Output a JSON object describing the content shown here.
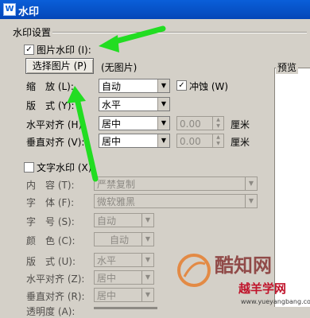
{
  "window": {
    "title": "水印"
  },
  "section": {
    "title": "水印设置",
    "preview_label": "预览"
  },
  "picture_watermark": {
    "label": "图片水印 (I):",
    "checked": true,
    "select_button": "选择图片 (P)",
    "status": "(无图片)",
    "scale_label": "缩　放 (L):",
    "scale_value": "自动",
    "washout_label": "冲蚀 (W)",
    "washout_checked": true,
    "layout_label": "版　式 (Y):",
    "layout_value": "水平",
    "h_align_label": "水平对齐 (H):",
    "h_align_value": "居中",
    "h_offset": "0.00",
    "h_unit": "厘米",
    "v_align_label": "垂直对齐 (V):",
    "v_align_value": "居中",
    "v_offset": "0.00",
    "v_unit": "厘米"
  },
  "text_watermark": {
    "label": "文字水印 (X)",
    "checked": false,
    "content_label": "内　容 (T):",
    "content_value": "严禁复制",
    "font_label": "字　体 (F):",
    "font_value": "微软雅黑",
    "size_label": "字　号 (S):",
    "size_value": "自动",
    "color_label": "颜　色 (C):",
    "color_value": "自动",
    "layout_label": "版　式 (U):",
    "layout_value": "水平",
    "h_align_label": "水平对齐 (Z):",
    "h_align_value": "居中",
    "v_align_label": "垂直对齐 (R):",
    "v_align_value": "居中",
    "transparency_label": "透明度 (A):"
  },
  "overlay_watermark": {
    "main": "酷知网",
    "brand": "越羊学网",
    "url": "www.yueyangbang.com"
  },
  "icons": [
    "app-icon",
    "checkmark-icon",
    "dropdown-arrow-icon",
    "spin-arrows-icon",
    "annotation-arrow-icon"
  ],
  "colors": {
    "annotation_arrow": "#22dd22",
    "titlebar": "#0a5fd9"
  }
}
